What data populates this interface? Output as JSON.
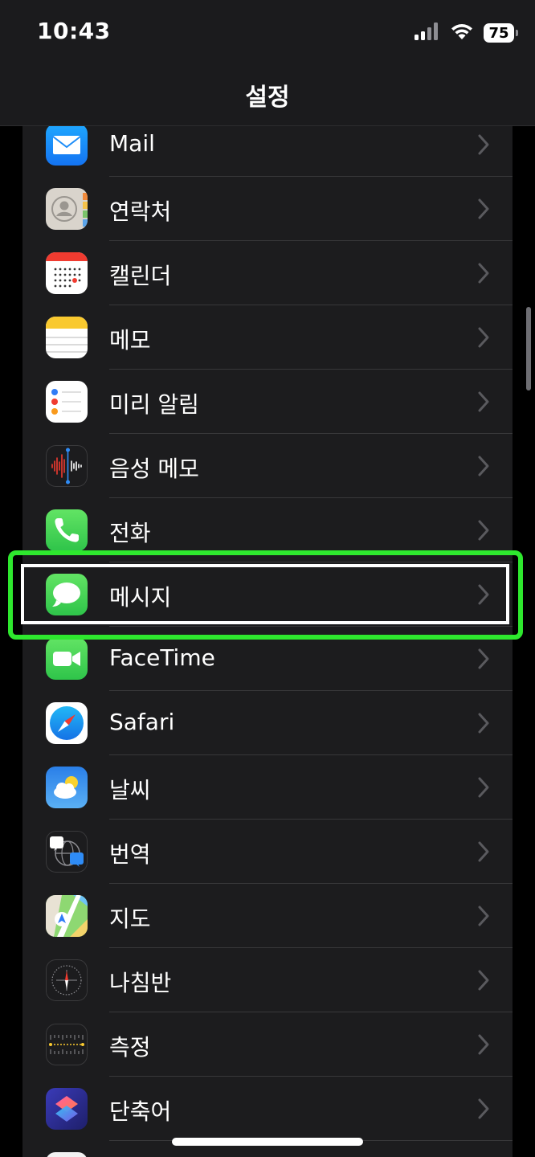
{
  "status_bar": {
    "time": "10:43",
    "battery": "75",
    "signal_icon": "cellular-signal-icon",
    "wifi_icon": "wifi-icon"
  },
  "nav": {
    "title": "설정"
  },
  "settings": {
    "items": [
      {
        "label": "Mail",
        "icon": "mail-icon"
      },
      {
        "label": "연락처",
        "icon": "contacts-icon"
      },
      {
        "label": "캘린더",
        "icon": "calendar-icon"
      },
      {
        "label": "메모",
        "icon": "notes-icon"
      },
      {
        "label": "미리 알림",
        "icon": "reminders-icon"
      },
      {
        "label": "음성 메모",
        "icon": "voice-memos-icon"
      },
      {
        "label": "전화",
        "icon": "phone-icon"
      },
      {
        "label": "메시지",
        "icon": "messages-icon",
        "highlighted": true
      },
      {
        "label": "FaceTime",
        "icon": "facetime-icon"
      },
      {
        "label": "Safari",
        "icon": "safari-icon"
      },
      {
        "label": "날씨",
        "icon": "weather-icon"
      },
      {
        "label": "번역",
        "icon": "translate-icon"
      },
      {
        "label": "지도",
        "icon": "maps-icon"
      },
      {
        "label": "나침반",
        "icon": "compass-icon"
      },
      {
        "label": "측정",
        "icon": "measure-icon"
      },
      {
        "label": "단축어",
        "icon": "shortcuts-icon"
      }
    ]
  },
  "colors": {
    "highlight": "#2ee82e",
    "background": "#000000",
    "cell": "#1c1c1e"
  }
}
